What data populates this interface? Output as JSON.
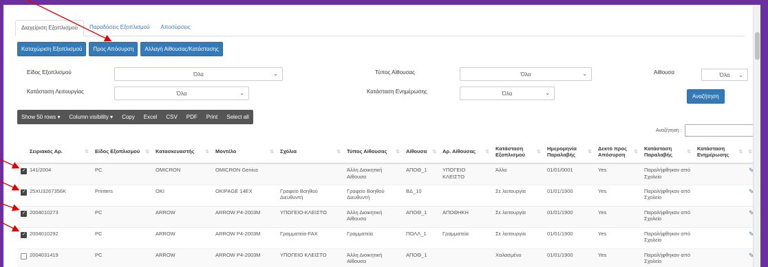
{
  "tabs": [
    "Διαχείριση Εξοπλισμού",
    "Παραδόσεις Εξοπλισμού",
    "Αποσύρσεις"
  ],
  "actions": [
    "Καταχώριση Εξοπλισμού",
    "Προς Απόσυρση",
    "Αλλαγή Αίθουσας/Κατάστασης"
  ],
  "filters": {
    "equipment_type_label": "Είδος Εξοπλισμού",
    "equipment_type_value": "Όλα",
    "room_type_label": "Τύπος Αίθουσας",
    "room_type_value": "Όλα",
    "room_label": "Αίθουσα",
    "room_value": "Όλα",
    "operation_status_label": "Κατάσταση Λειτουργίας",
    "operation_status_value": "Όλα",
    "update_status_label": "Κατάσταση Ενημέρωσης",
    "update_status_value": "Όλα",
    "search_button": "Αναζήτηση"
  },
  "toolbar": [
    "Show 50 rows ▾",
    "Column visibility ▾",
    "Copy",
    "Excel",
    "CSV",
    "PDF",
    "Print",
    "Select all"
  ],
  "search_label": "Αναζήτηση :",
  "columns": [
    "",
    "Σειριακός Αρ.",
    "Είδος Εξοπλισμού",
    "Κατασκευαστής",
    "Μοντέλο",
    "Σχόλια",
    "Τύπος Αίθουσας",
    "Αίθουσα",
    "Αρ. Αίθουσας",
    "Κατάσταση Εξοπλισμού",
    "Ημερομηνία Παραλαβής",
    "Δεκτό προς Απόσυρση",
    "Κατάσταση Παραλαβής",
    "Κατάσταση Ενημέρωσης",
    ""
  ],
  "rows": [
    {
      "checked": true,
      "serial": "141/2004",
      "type": "PC",
      "manufacturer": "OMICRON",
      "model": "OMICRON Genius",
      "comments": "",
      "room_type": "Άλλη Διοικητική Αίθουσα",
      "room": "ΑΠΟΘ_1",
      "room_no": "ΥΠΟΓΕΙΟ ΚΛΕΙΣΤΟ",
      "status": "Άλλο",
      "date": "01/01/0001",
      "withdraw": "Yes",
      "receipt": "Παραλήφθηκαν από Σχολείο",
      "update": ""
    },
    {
      "checked": true,
      "serial": "25XU3267356K",
      "type": "Printers",
      "manufacturer": "OKI",
      "model": "OKIPAGE 14EX",
      "comments": "Γραφείο Βοηθού Διευθυντή",
      "room_type": "Γραφείο Βοηθού Διευθυντή",
      "room": "ΒΔ_10",
      "room_no": "",
      "status": "Σε λειτουργία",
      "date": "01/01/1900",
      "withdraw": "Yes",
      "receipt": "Παραλήφθηκαν από Σχολείο",
      "update": ""
    },
    {
      "checked": true,
      "serial": "2004010273",
      "type": "PC",
      "manufacturer": "ARROW",
      "model": "ARROW P4-2003M",
      "comments": "ΥΠΟΓΕΙΟ-ΚΛΕΙΣΤΟ",
      "room_type": "Άλλη Διοικητική Αίθουσα",
      "room": "ΑΠΟΘ_1",
      "room_no": "ΑΠΟΘΗΚΗ",
      "status": "Σε λειτουργία",
      "date": "01/01/1900",
      "withdraw": "Yes",
      "receipt": "Παραλήφθηκαν από Σχολείο",
      "update": ""
    },
    {
      "checked": true,
      "serial": "2004010292",
      "type": "PC",
      "manufacturer": "ARROW",
      "model": "ARROW P4-2003M",
      "comments": "Γραμματεία-FAX",
      "room_type": "Γραμματεία",
      "room": "ΠΟΛΛ_1",
      "room_no": "Γραμματεία",
      "status": "Σε λειτουργία",
      "date": "01/01/1900",
      "withdraw": "Yes",
      "receipt": "Παραλήφθηκαν από Σχολείο",
      "update": ""
    },
    {
      "checked": false,
      "serial": "2004031419",
      "type": "PC",
      "manufacturer": "ARROW",
      "model": "ARROW P4-2003M",
      "comments": "ΥΠΟΓΕΙΟ ΚΛΕΙΣΤΟ",
      "room_type": "Άλλη Διοικητική Αίθουσα",
      "room": "ΑΠΟΘ_1",
      "room_no": "",
      "status": "Χαλασμένο",
      "date": "01/01/1900",
      "withdraw": "Yes",
      "receipt": "Παραλήφθηκαν από Σχολείο",
      "update": ""
    }
  ],
  "colors": {
    "frame": "#6b2fa0",
    "primary": "#337ab7",
    "toolbar": "#555555",
    "annotation_arrow": "#e00000"
  }
}
